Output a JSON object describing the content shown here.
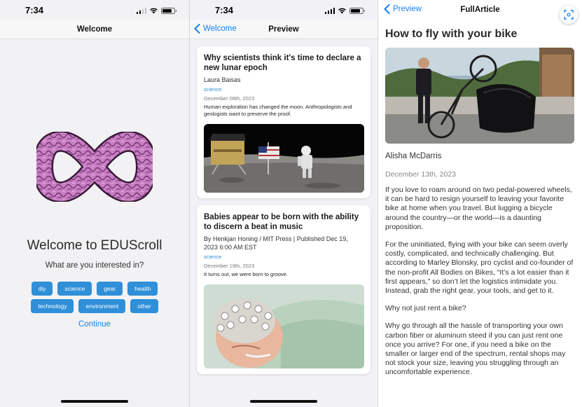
{
  "screen1": {
    "time": "7:34",
    "nav_title": "Welcome",
    "welcome_title": "Welcome to EDUScroll",
    "subtitle": "What are you interested in?",
    "chips_row1": [
      "diy",
      "science",
      "gear",
      "health"
    ],
    "chips_row2": [
      "technology",
      "environment",
      "other"
    ],
    "continue_label": "Continue"
  },
  "screen2": {
    "time": "7:34",
    "back_label": "Welcome",
    "nav_title": "Preview",
    "cards": [
      {
        "title": "Why scientists think it's time to declare a new lunar epoch",
        "author": "Laura Baisas",
        "category": "science",
        "date": "December 08th, 2023",
        "description": "Human exploration has changed the moon. Anthropologists and geologists want to preserve the proof."
      },
      {
        "title": "Babies appear to be born with the ability to discern a beat in music",
        "author": "By Henkjan Honing / MIT Press | Published Dec 19, 2023 6:00 AM EST",
        "category": "science",
        "date": "December 19th, 2023",
        "description": "It turns out, we were born to groove."
      }
    ]
  },
  "screen3": {
    "back_label": "Preview",
    "nav_title": "FullArticle",
    "title": "How to fly with your bike",
    "author": "Alisha McDarris",
    "date": "December 13th, 2023",
    "paragraphs": [
      "If you love to roam around on two pedal-powered wheels, it can be hard to resign yourself to leaving your favorite bike at home when you travel. But lugging a bicycle around the country—or the world—is a daunting proposition.",
      "For the uninitiated, flying with your bike can seem overly costly, complicated, and technically challenging. But according to Marley Blonsky, pro cyclist and co-founder of the non-profit All Bodies on Bikes, “It’s a lot easier than it first appears,” so don’t let the logistics intimidate you. Instead, grab the right gear, your tools, and get to it.",
      "Why not just rent a bike?",
      "Why go through all the hassle of transporting your own carbon fiber or aluminum steed if you can just rent one once you arrive? For one, if you need a bike on the smaller or larger end of the spectrum, rental shops may not stock your size, leaving you struggling through an uncomfortable experience."
    ]
  },
  "colors": {
    "accent": "#1a7ef2",
    "chip": "#2f8fd8",
    "brain": "#c47fbf"
  },
  "icons": [
    "signal-icon",
    "wifi-icon",
    "battery-icon",
    "back-chevron-icon",
    "scan-text-icon"
  ]
}
